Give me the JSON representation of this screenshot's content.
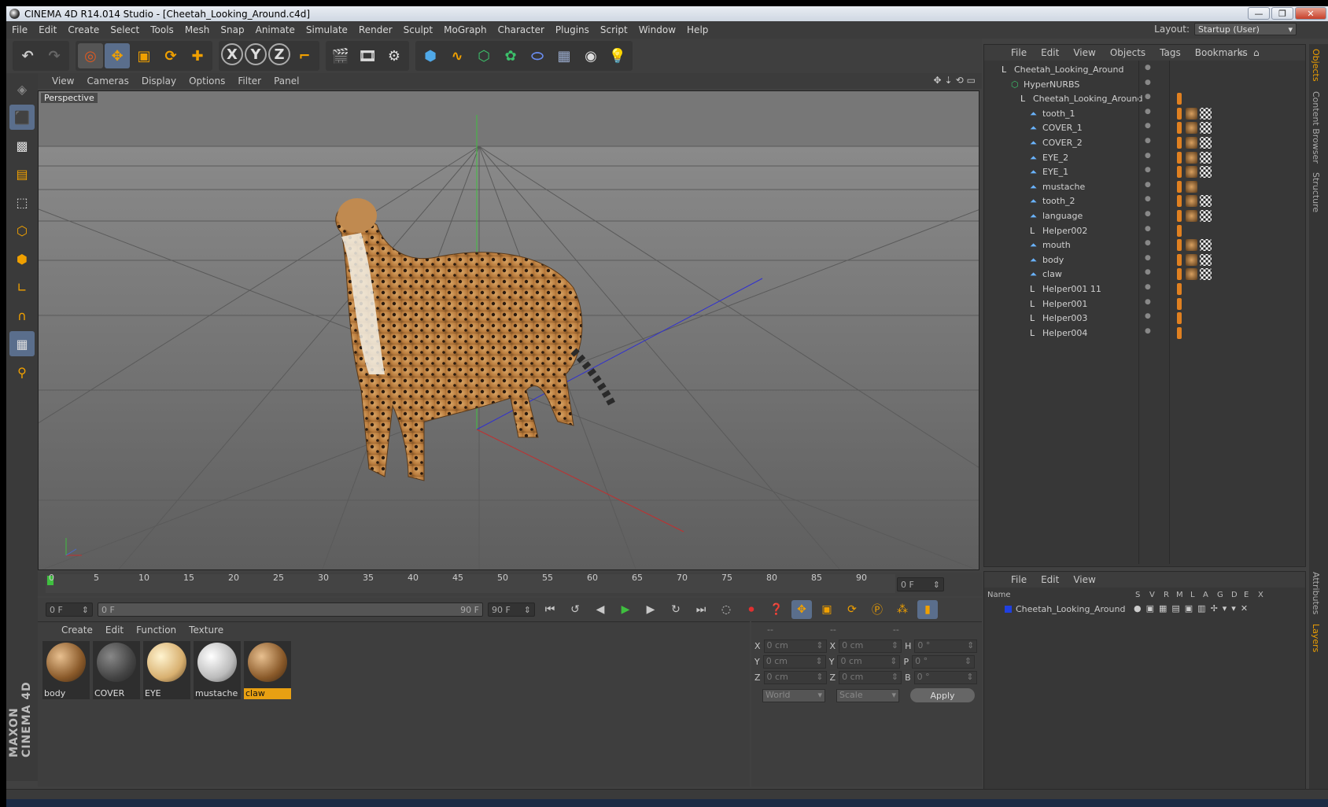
{
  "window": {
    "title": "CINEMA 4D R14.014 Studio - [Cheetah_Looking_Around.c4d]",
    "minimize": "—",
    "restore": "❐",
    "close": "✕"
  },
  "menu": [
    "File",
    "Edit",
    "Create",
    "Select",
    "Tools",
    "Mesh",
    "Snap",
    "Animate",
    "Simulate",
    "Render",
    "Sculpt",
    "MoGraph",
    "Character",
    "Plugins",
    "Script",
    "Window",
    "Help"
  ],
  "layout": {
    "label": "Layout:",
    "value": "Startup (User)"
  },
  "viewport": {
    "menu": [
      "View",
      "Cameras",
      "Display",
      "Options",
      "Filter",
      "Panel"
    ],
    "label": "Perspective"
  },
  "timeline": {
    "ticks": [
      "0",
      "5",
      "10",
      "15",
      "20",
      "25",
      "30",
      "35",
      "40",
      "45",
      "50",
      "55",
      "60",
      "65",
      "70",
      "75",
      "80",
      "85",
      "90"
    ],
    "current": "0 F"
  },
  "playback": {
    "start": "0 F",
    "range_start": "0 F",
    "range_end": "90 F",
    "end": "90 F"
  },
  "materials": {
    "menu": [
      "Create",
      "Edit",
      "Function",
      "Texture"
    ],
    "items": [
      {
        "name": "body"
      },
      {
        "name": "COVER"
      },
      {
        "name": "EYE"
      },
      {
        "name": "mustache"
      },
      {
        "name": "claw"
      }
    ]
  },
  "coords": {
    "head": [
      "--",
      "--",
      "--"
    ],
    "rows": [
      {
        "a": "X",
        "av": "0 cm",
        "b": "X",
        "bv": "0 cm",
        "c": "H",
        "cv": "0 °"
      },
      {
        "a": "Y",
        "av": "0 cm",
        "b": "Y",
        "bv": "0 cm",
        "c": "P",
        "cv": "0 °"
      },
      {
        "a": "Z",
        "av": "0 cm",
        "b": "Z",
        "bv": "0 cm",
        "c": "B",
        "cv": "0 °"
      }
    ],
    "mode": "World",
    "type": "Scale",
    "apply": "Apply"
  },
  "objects": {
    "menu": [
      "File",
      "Edit",
      "View",
      "Objects",
      "Tags",
      "Bookmarks"
    ],
    "items": [
      {
        "name": "Cheetah_Looking_Around",
        "indent": 0
      },
      {
        "name": "HyperNURBS",
        "indent": 1
      },
      {
        "name": "Cheetah_Looking_Around",
        "indent": 2
      },
      {
        "name": "tooth_1",
        "indent": 3
      },
      {
        "name": "COVER_1",
        "indent": 3
      },
      {
        "name": "COVER_2",
        "indent": 3
      },
      {
        "name": "EYE_2",
        "indent": 3
      },
      {
        "name": "EYE_1",
        "indent": 3
      },
      {
        "name": "mustache",
        "indent": 3
      },
      {
        "name": "tooth_2",
        "indent": 3
      },
      {
        "name": "language",
        "indent": 3
      },
      {
        "name": "Helper002",
        "indent": 3
      },
      {
        "name": "mouth",
        "indent": 3
      },
      {
        "name": "body",
        "indent": 3
      },
      {
        "name": "claw",
        "indent": 3
      },
      {
        "name": "Helper001 11",
        "indent": 3
      },
      {
        "name": "Helper001",
        "indent": 3
      },
      {
        "name": "Helper003",
        "indent": 3
      },
      {
        "name": "Helper004",
        "indent": 3
      }
    ]
  },
  "layers": {
    "menu": [
      "File",
      "Edit",
      "View"
    ],
    "cols": [
      "Name",
      "S",
      "V",
      "R",
      "M",
      "L",
      "A",
      "G",
      "D",
      "E",
      "X"
    ],
    "item": "Cheetah_Looking_Around"
  },
  "sidetabs": [
    "Objects",
    "Content Browser",
    "Structure"
  ],
  "sidetabs2": [
    "Attributes",
    "Layers"
  ],
  "branding": "MAXON CINEMA 4D",
  "colors": {
    "accent": "#e8a012",
    "background": "#414141",
    "viewport": "#6c6c6c"
  }
}
